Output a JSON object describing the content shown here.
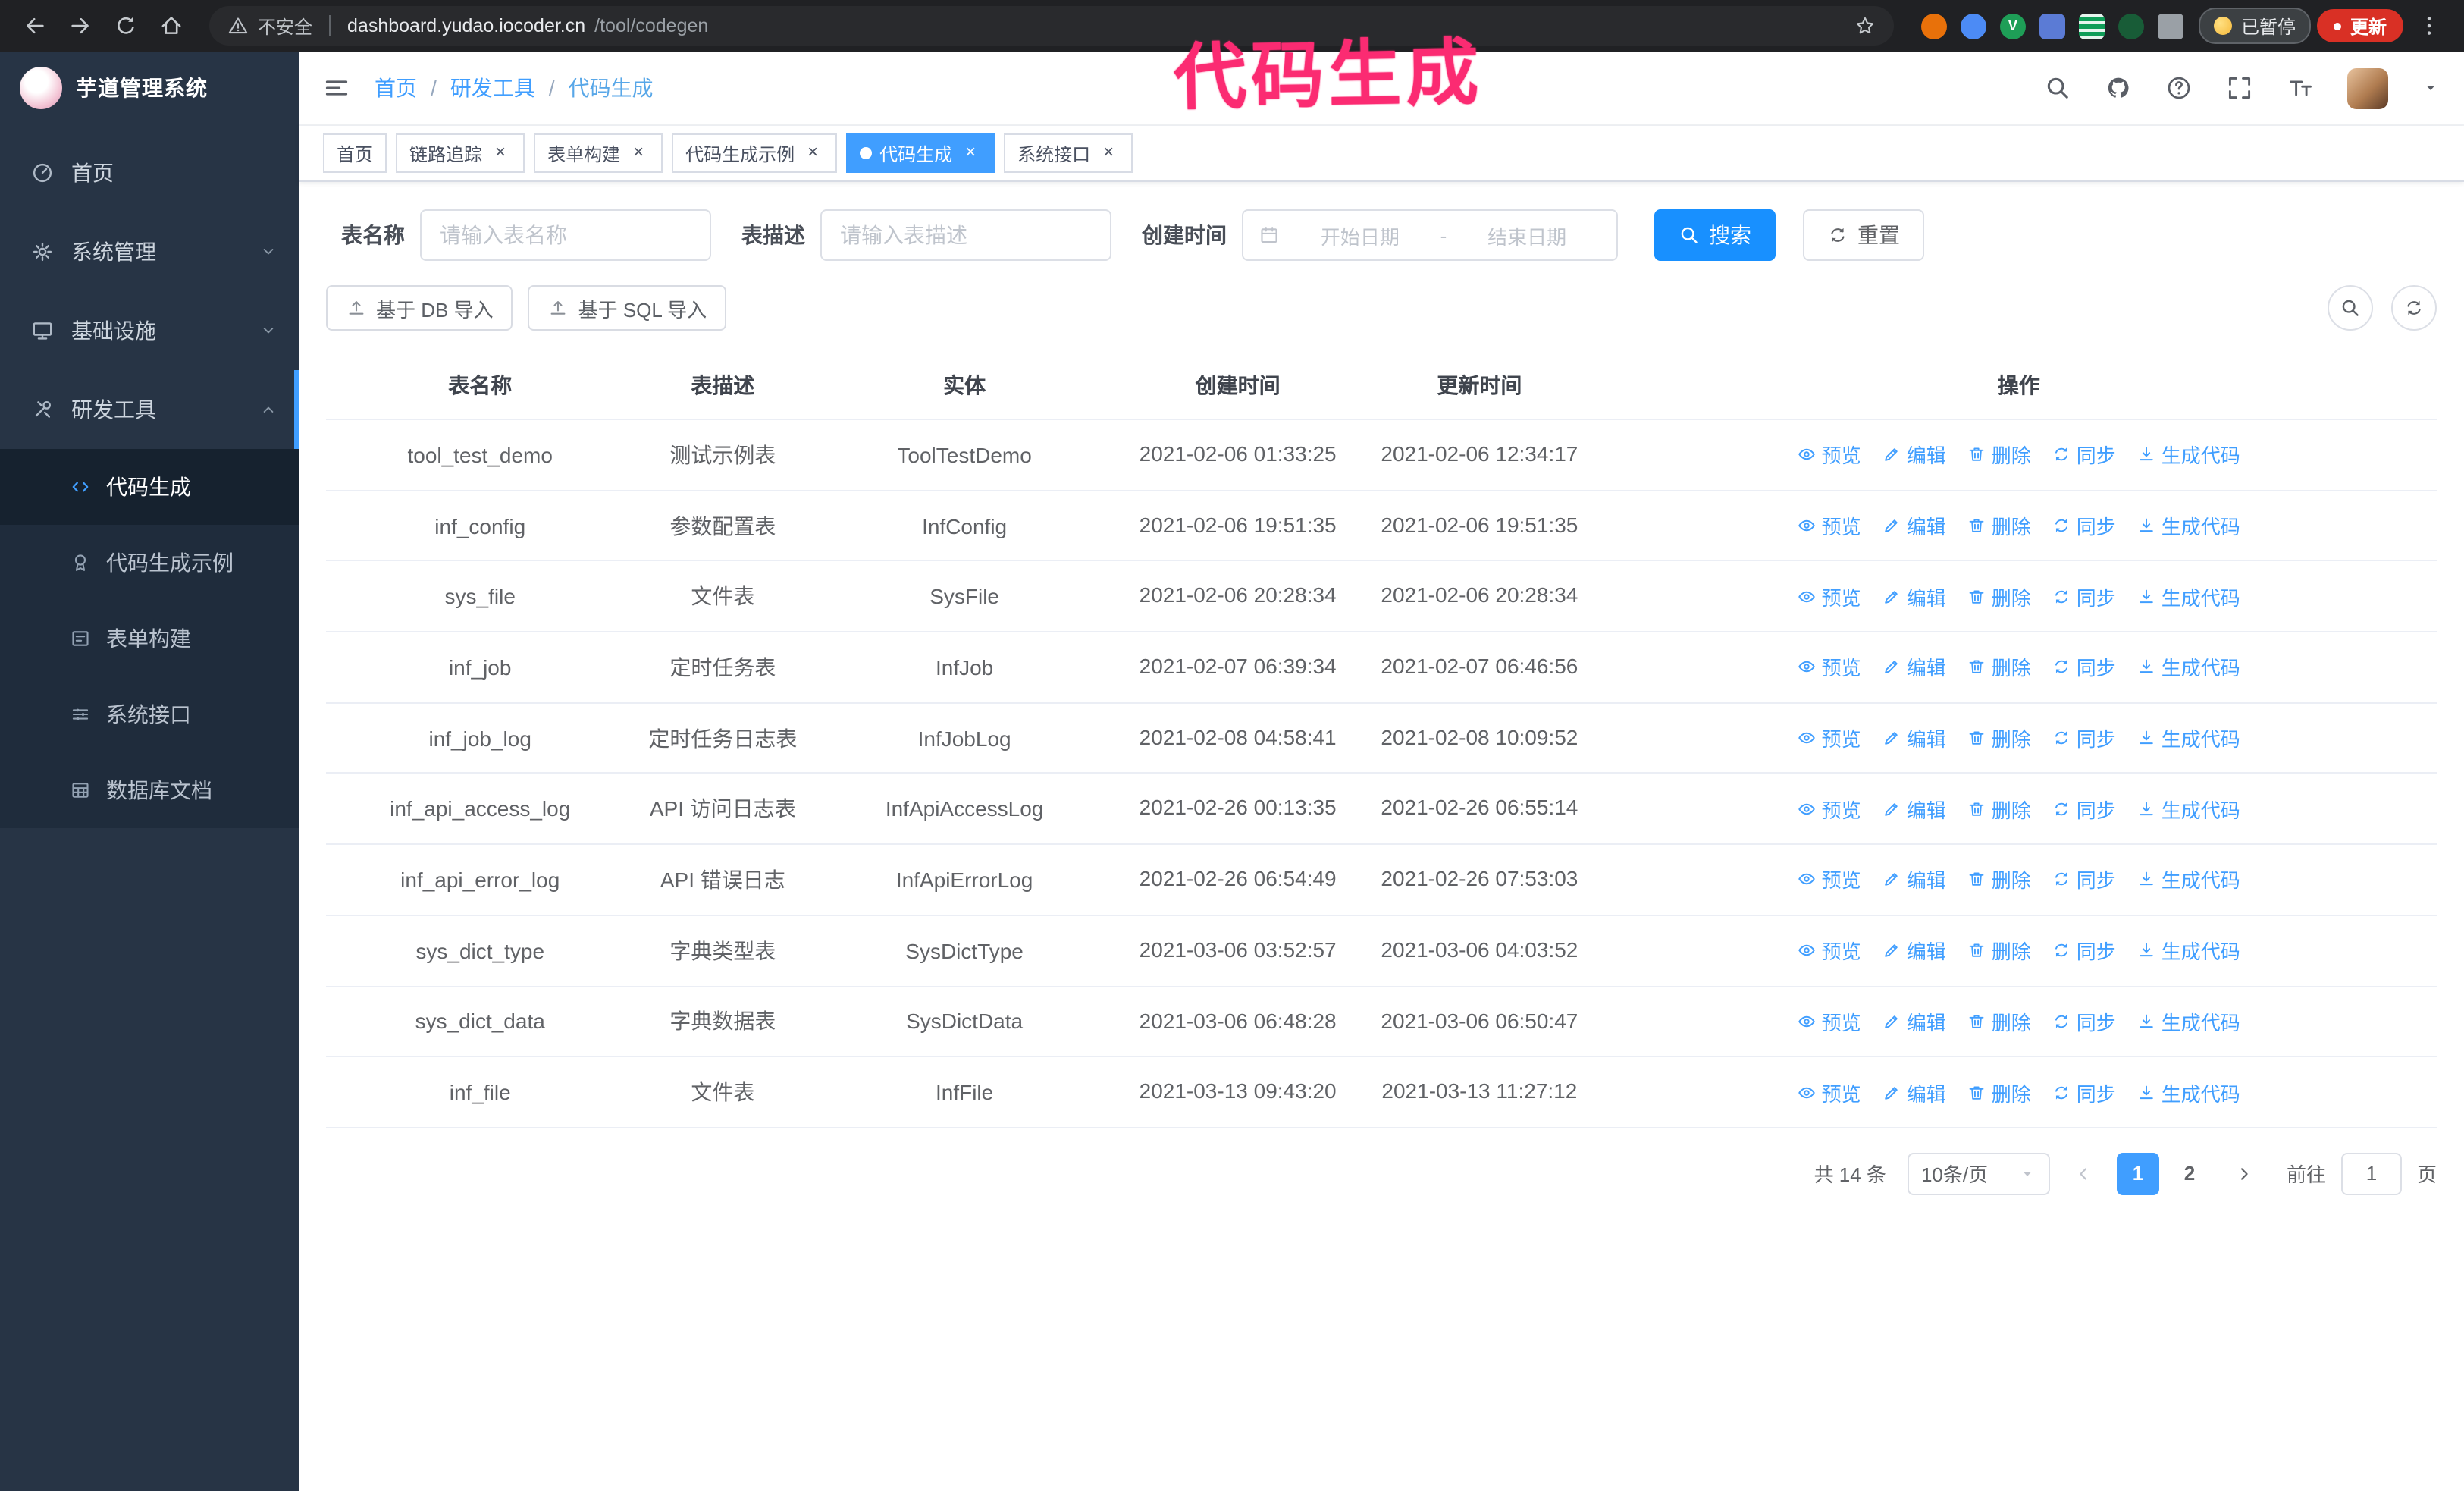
{
  "theme": {
    "primary": "#409eff",
    "button_primary": "#1890ff",
    "annotation_pink": "#fb2b72",
    "sidebar_bg": "#273445",
    "sidebar_submenu_bg": "#1f2c3c",
    "chrome_bg": "#202124",
    "update_button_bg": "#d93025"
  },
  "browser": {
    "security_label": "不安全",
    "url_host": "dashboard.yudao.iocoder.cn",
    "url_path": "/tool/codegen",
    "paused_badge": "已暂停",
    "update_button": "更新"
  },
  "annotation": {
    "text": "代码生成"
  },
  "sidebar": {
    "logo_title": "芋道管理系统",
    "items": [
      {
        "label": "首页",
        "icon": "gauge"
      },
      {
        "label": "系统管理",
        "icon": "gear",
        "chevron": "down"
      },
      {
        "label": "基础设施",
        "icon": "monitor",
        "chevron": "down"
      },
      {
        "label": "研发工具",
        "icon": "tools",
        "chevron": "up",
        "expanded": true
      }
    ],
    "subitems": [
      {
        "label": "代码生成",
        "icon": "code",
        "active": true
      },
      {
        "label": "代码生成示例",
        "icon": "badge"
      },
      {
        "label": "表单构建",
        "icon": "form"
      },
      {
        "label": "系统接口",
        "icon": "api"
      },
      {
        "label": "数据库文档",
        "icon": "grid"
      }
    ]
  },
  "header": {
    "breadcrumb": [
      "首页",
      "研发工具",
      "代码生成"
    ]
  },
  "tabs": [
    {
      "label": "首页",
      "closable": false,
      "active": false
    },
    {
      "label": "链路追踪",
      "closable": true,
      "active": false
    },
    {
      "label": "表单构建",
      "closable": true,
      "active": false
    },
    {
      "label": "代码生成示例",
      "closable": true,
      "active": false
    },
    {
      "label": "代码生成",
      "closable": true,
      "active": true
    },
    {
      "label": "系统接口",
      "closable": true,
      "active": false
    }
  ],
  "filters": {
    "table_name_label": "表名称",
    "table_name_placeholder": "请输入表名称",
    "table_desc_label": "表描述",
    "table_desc_placeholder": "请输入表描述",
    "create_time_label": "创建时间",
    "date_start_placeholder": "开始日期",
    "date_separator": "-",
    "date_end_placeholder": "结束日期",
    "search_button": "搜索",
    "reset_button": "重置"
  },
  "toolbar": {
    "import_db": "基于 DB 导入",
    "import_sql": "基于 SQL 导入"
  },
  "table": {
    "columns": [
      "表名称",
      "表描述",
      "实体",
      "创建时间",
      "更新时间",
      "操作"
    ],
    "actions": [
      {
        "label": "预览",
        "icon": "eye"
      },
      {
        "label": "编辑",
        "icon": "edit"
      },
      {
        "label": "删除",
        "icon": "trash"
      },
      {
        "label": "同步",
        "icon": "sync"
      },
      {
        "label": "生成代码",
        "icon": "download"
      }
    ],
    "rows": [
      {
        "name": "tool_test_demo",
        "desc": "测试示例表",
        "entity": "ToolTestDemo",
        "created": "2021-02-06 01:33:25",
        "updated": "2021-02-06 12:34:17"
      },
      {
        "name": "inf_config",
        "desc": "参数配置表",
        "entity": "InfConfig",
        "created": "2021-02-06 19:51:35",
        "updated": "2021-02-06 19:51:35"
      },
      {
        "name": "sys_file",
        "desc": "文件表",
        "entity": "SysFile",
        "created": "2021-02-06 20:28:34",
        "updated": "2021-02-06 20:28:34"
      },
      {
        "name": "inf_job",
        "desc": "定时任务表",
        "entity": "InfJob",
        "created": "2021-02-07 06:39:34",
        "updated": "2021-02-07 06:46:56"
      },
      {
        "name": "inf_job_log",
        "desc": "定时任务日志表",
        "entity": "InfJobLog",
        "created": "2021-02-08 04:58:41",
        "updated": "2021-02-08 10:09:52"
      },
      {
        "name": "inf_api_access_log",
        "desc": "API 访问日志表",
        "entity": "InfApiAccessLog",
        "created": "2021-02-26 00:13:35",
        "updated": "2021-02-26 06:55:14"
      },
      {
        "name": "inf_api_error_log",
        "desc": "API 错误日志",
        "entity": "InfApiErrorLog",
        "created": "2021-02-26 06:54:49",
        "updated": "2021-02-26 07:53:03"
      },
      {
        "name": "sys_dict_type",
        "desc": "字典类型表",
        "entity": "SysDictType",
        "created": "2021-03-06 03:52:57",
        "updated": "2021-03-06 04:03:52"
      },
      {
        "name": "sys_dict_data",
        "desc": "字典数据表",
        "entity": "SysDictData",
        "created": "2021-03-06 06:48:28",
        "updated": "2021-03-06 06:50:47"
      },
      {
        "name": "inf_file",
        "desc": "文件表",
        "entity": "InfFile",
        "created": "2021-03-13 09:43:20",
        "updated": "2021-03-13 11:27:12"
      }
    ]
  },
  "pagination": {
    "total": "共 14 条",
    "page_size": "10条/页",
    "pages": [
      {
        "label": "1",
        "active": true
      },
      {
        "label": "2",
        "active": false
      }
    ],
    "goto_label": "前往",
    "goto_value": "1",
    "goto_suffix": "页"
  },
  "icons": {
    "close": "×"
  }
}
